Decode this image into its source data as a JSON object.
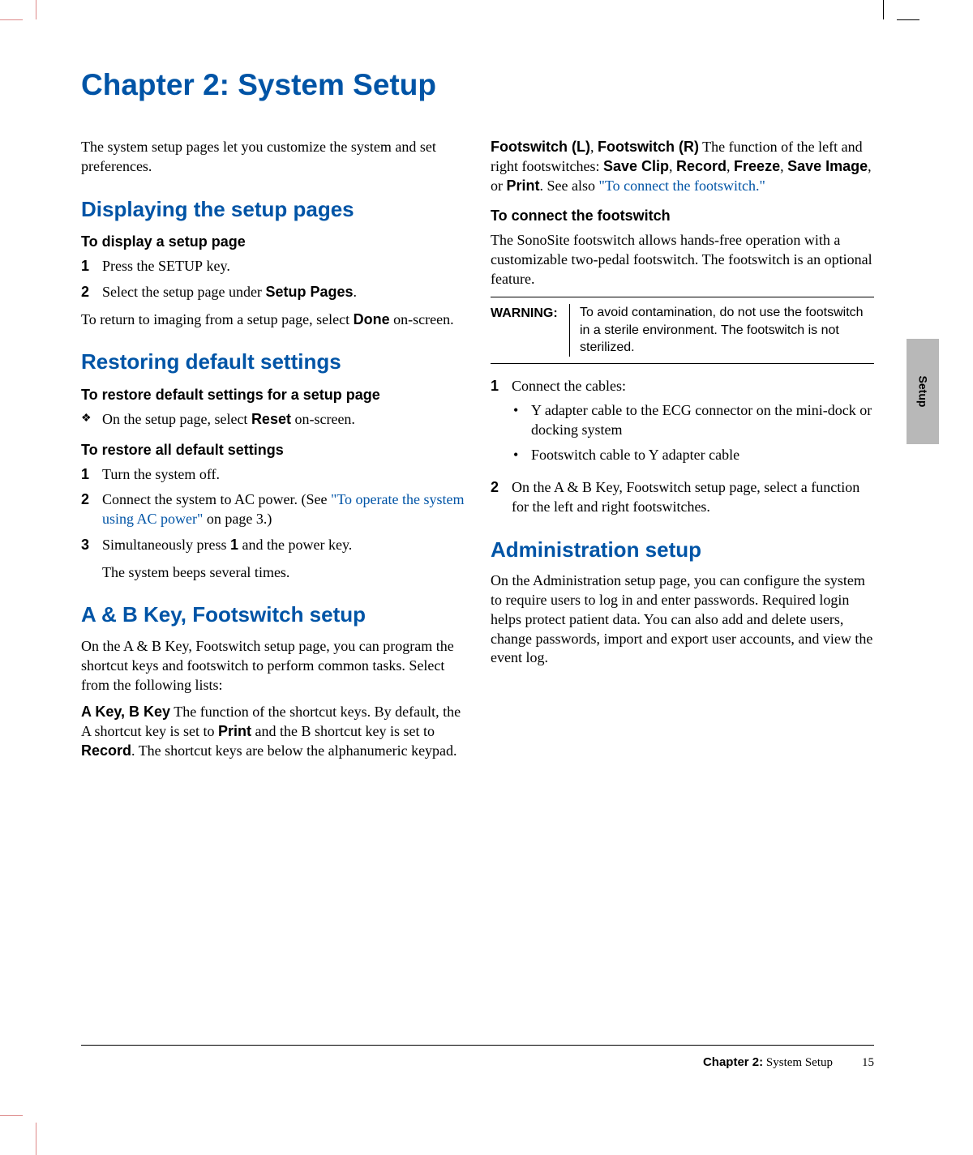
{
  "sideTab": "Setup",
  "chapterTitle": "Chapter 2: System Setup",
  "intro": "The system setup pages let you customize the system and set preferences.",
  "sections": {
    "displaying": {
      "heading": "Displaying the setup pages",
      "sub1": "To display a setup page",
      "step1a": "Press the ",
      "step1b": " key.",
      "setupKey": "SETUP",
      "step2a": "Select the setup page under ",
      "step2b": "Setup Pages",
      "step2c": ".",
      "returnA": "To return to imaging from a setup page, select ",
      "returnB": "Done",
      "returnC": " on-screen."
    },
    "restoring": {
      "heading": "Restoring default settings",
      "sub1": "To restore default settings for a setup page",
      "bullet1a": "On the setup page, select ",
      "bullet1b": "Reset",
      "bullet1c": " on-screen.",
      "sub2": "To restore all default settings",
      "s1": "Turn the system off.",
      "s2a": "Connect the system to AC power. (See ",
      "s2link": "\"To operate the system using AC power\"",
      "s2b": " on page 3.)",
      "s3a": "Simultaneously press ",
      "s3b": "1",
      "s3c": " and the power key.",
      "s3d": "The system beeps several times."
    },
    "abkey": {
      "heading": "A & B Key, Footswitch setup",
      "p1": "On the A & B Key, Footswitch setup page, you can program the shortcut keys and footswitch to perform common tasks. Select from the following lists:",
      "p2a": "A Key, B Key",
      "p2b": " The function of the shortcut keys. By default, the A shortcut key is set to ",
      "p2c": "Print",
      "p2d": " and the B shortcut key is set to ",
      "p2e": "Record",
      "p2f": ". The shortcut keys are below the alphanumeric keypad."
    },
    "footswitch": {
      "p1a": "Footswitch (L)",
      "p1sep": ", ",
      "p1b": "Footswitch (R)",
      "p1c": " The function of the left and right footswitches: ",
      "opt1": "Save Clip",
      "opt2": "Record",
      "opt3": "Freeze",
      "opt4": "Save Image",
      "opt5": "Print",
      "p1d": ". See also ",
      "link": "\"To connect the footswitch.\"",
      "sub": "To connect the footswitch",
      "p2": "The SonoSite footswitch allows hands-free operation with a customizable two-pedal footswitch. The footswitch is an optional feature.",
      "warnLabel": "WARNING:",
      "warnText": "To avoid contamination, do not use the footswitch in a sterile environment. The footswitch is not sterilized.",
      "s1": "Connect the cables:",
      "b1": "Y adapter cable to the ECG connector on the mini-dock or docking system",
      "b2": "Footswitch cable to Y adapter cable",
      "s2": "On the A & B Key, Footswitch setup page, select a function for the left and right footswitches."
    },
    "admin": {
      "heading": "Administration setup",
      "p1": "On the Administration setup page, you can configure the system to require users to log in and enter passwords. Required login helps protect patient data. You can also add and delete users, change passwords, import and export user accounts, and view the event log."
    }
  },
  "footer": {
    "chapter": "Chapter 2:",
    "title": "  System Setup",
    "page": "15"
  }
}
